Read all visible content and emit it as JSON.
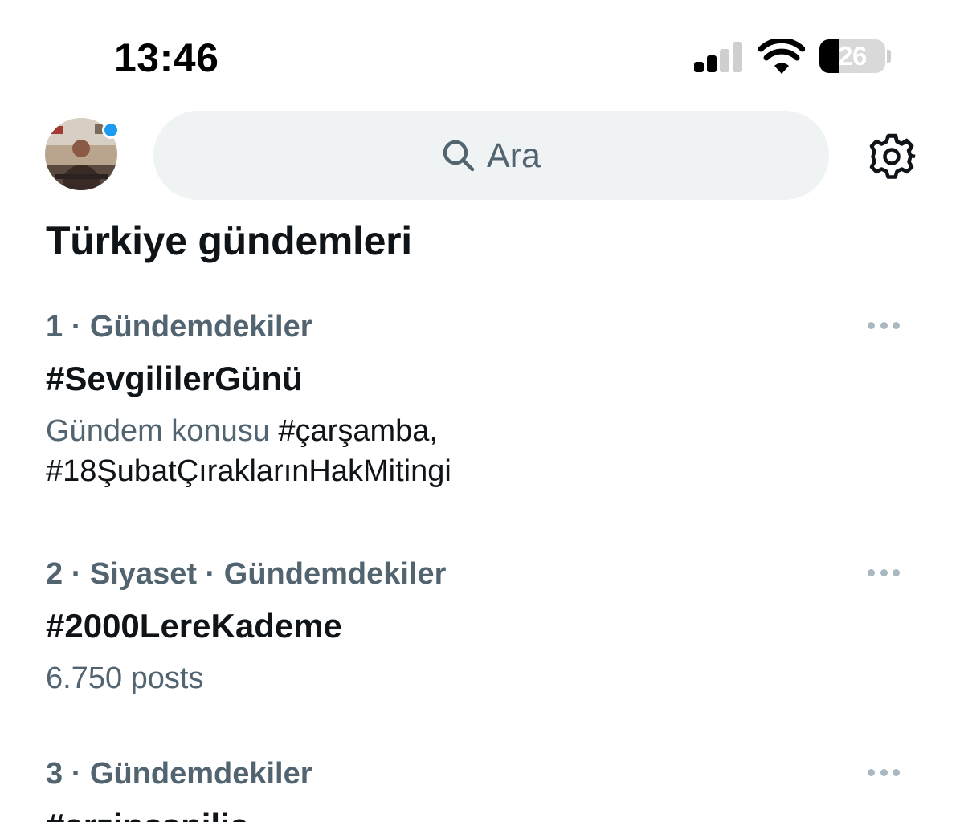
{
  "status_bar": {
    "time": "13:46",
    "battery_level": "26"
  },
  "header": {
    "search_placeholder": "Ara"
  },
  "page": {
    "title": "Türkiye gündemleri"
  },
  "trends": [
    {
      "rank": "1",
      "meta": "1 · Gündemdekiler",
      "title": "#SevgililerGünü",
      "desc_prefix": "Gündem konusu ",
      "desc_tag1": "#çarşamba,",
      "desc_tag2": "#18ŞubatÇırakların­HakMitingi"
    },
    {
      "rank": "2",
      "meta": "2 · Siyaset · Gündemdekiler",
      "title": "#2000LereKademe",
      "posts": "6.750 posts"
    },
    {
      "rank": "3",
      "meta": "3 · Gündemdekiler",
      "title": "#erzincanilic"
    }
  ],
  "colors": {
    "accent": "#1d9bf0",
    "secondary_text": "#536471",
    "primary_text": "#0f1419",
    "search_bg": "#eff3f4"
  },
  "icons": [
    "search-icon",
    "gear-icon",
    "more-icon",
    "signal-icon",
    "wifi-icon",
    "battery-icon"
  ]
}
